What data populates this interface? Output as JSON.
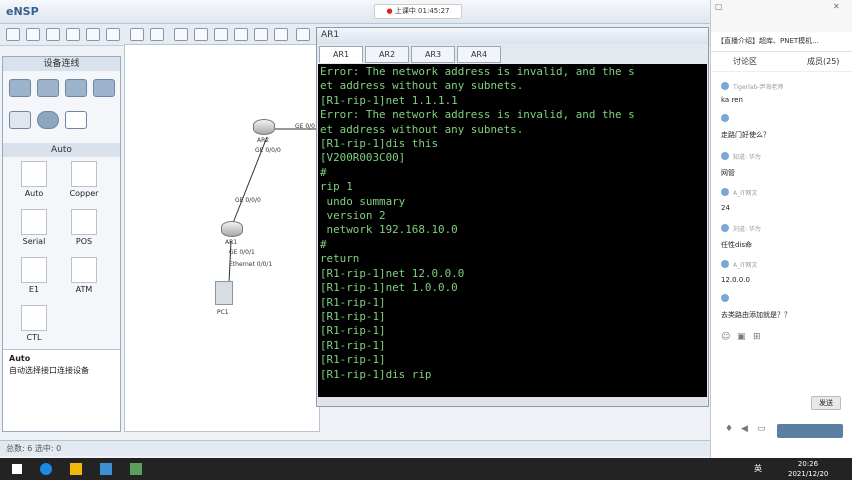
{
  "ensp": {
    "title": "eNSP",
    "device_panel_title": "设备连线",
    "cable_section_title": "Auto",
    "cables": [
      {
        "label": "Auto",
        "icon": "auto-cable-icon"
      },
      {
        "label": "Copper",
        "icon": "copper-cable-icon"
      },
      {
        "label": "Serial",
        "icon": "serial-cable-icon"
      },
      {
        "label": "POS",
        "icon": "pos-cable-icon"
      },
      {
        "label": "E1",
        "icon": "e1-cable-icon"
      },
      {
        "label": "ATM",
        "icon": "atm-cable-icon"
      },
      {
        "label": "CTL",
        "icon": "ctl-cable-icon"
      }
    ],
    "description_title": "Auto",
    "description_text": "自动选择接口连接设备",
    "status_bar": "总数: 6  选中: 0"
  },
  "recording": {
    "status": "上课中 01:45:27"
  },
  "topology": {
    "ar2_name": "AR2",
    "ar2_port_down": "GE 0/0/0",
    "ar2_port_right": "GE 0/0",
    "ar1_name": "AR1",
    "ar1_port_up": "GE 0/0/0",
    "ar1_port_down": "GE 0/0/1",
    "pc1_port": "Ethernet 0/0/1",
    "pc1_name": "PC1"
  },
  "console": {
    "title": "AR1",
    "tabs": [
      "AR1",
      "AR2",
      "AR3",
      "AR4"
    ],
    "active_tab": "AR1",
    "lines": [
      "Error: The network address is invalid, and the s",
      "et address without any subnets.",
      "[R1-rip-1]net 1.1.1.1",
      "Error: The network address is invalid, and the s",
      "et address without any subnets.",
      "[R1-rip-1]dis this",
      "[V200R003C00]",
      "#",
      "rip 1",
      " undo summary",
      " version 2",
      " network 192.168.10.0",
      "#",
      "return",
      "[R1-rip-1]net 12.0.0.0",
      "[R1-rip-1]net 1.0.0.0",
      "[R1-rip-1]",
      "[R1-rip-1]",
      "[R1-rip-1]",
      "[R1-rip-1]",
      "[R1-rip-1]",
      "[R1-rip-1]dis rip"
    ]
  },
  "chat": {
    "header": "【直播介绍】超库、PNET模机...",
    "tab_discussion": "讨论区",
    "tab_members": "成员(25)",
    "messages": [
      {
        "name": "Tigerlab-尹海老师",
        "text": "ka ren"
      },
      {
        "name": "",
        "text": "走路门好使么？"
      },
      {
        "name": "知道: 华为",
        "text": "网管"
      },
      {
        "name": "A_IT网文",
        "text": "24"
      },
      {
        "name": "刘道: 华为",
        "text": "任性dis命"
      },
      {
        "name": "A_IT网文",
        "text": "12.0.0.0"
      },
      {
        "name": "",
        "text": "去类路由添加就是？？"
      }
    ],
    "send_label": "发送"
  },
  "taskbar": {
    "time": "20:26",
    "date": "2021/12/20",
    "ime": "英"
  },
  "colors": {
    "terminal_bg": "#000000",
    "terminal_fg": "#7fd07f",
    "taskbar": "#232323"
  }
}
